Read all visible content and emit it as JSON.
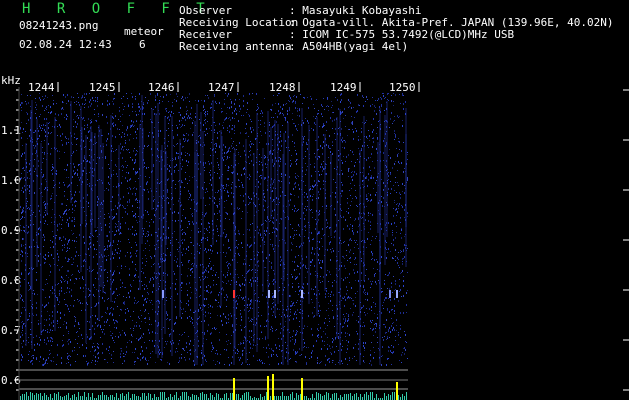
{
  "header": {
    "brand": "H R O F F T",
    "filename": "08241243.png",
    "datetime": "02.08.24 12:43",
    "meteor_label": "meteor",
    "meteor_count": "6"
  },
  "info": {
    "observer_label": "Observer",
    "observer_value": ": Masayuki Kobayashi",
    "location_label": "Receiving Location",
    "location_value": ": Ogata-vill. Akita-Pref. JAPAN (139.96E, 40.02N)",
    "receiver_label": "Receiver",
    "receiver_value": ": ICOM IC-575 53.7492(@LCD)MHz USB",
    "antenna_label": "Receiving antenna",
    "antenna_value": ": A504HB(yagi 4el)"
  },
  "axes": {
    "unit": "kHz",
    "y_ticks": [
      "1.1",
      "1.0",
      "0.9",
      "0.8",
      "0.7",
      "0.6"
    ],
    "time_labels": [
      "1244",
      "1245",
      "1246",
      "1247",
      "1248",
      "1249",
      "1250"
    ]
  },
  "colors": {
    "background": "#000000",
    "text": "#ffffff",
    "brand": "#33dd55",
    "spectrogram_noise": "#2233aa",
    "meteor_trace": "#ffff00",
    "axis": "#ffffff"
  }
}
